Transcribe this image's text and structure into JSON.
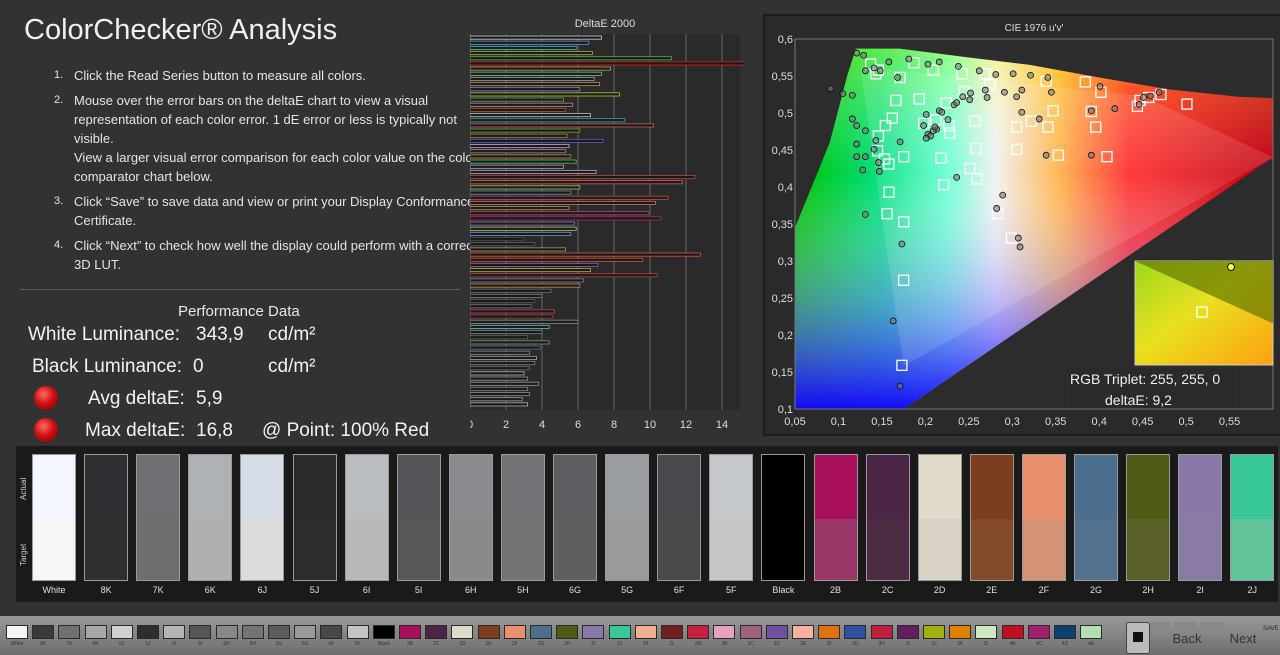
{
  "title": "ColorChecker® Analysis",
  "instructions": [
    {
      "num": "1.",
      "lines": [
        "Click the Read Series button to measure all colors."
      ]
    },
    {
      "num": "2.",
      "lines": [
        "Mouse over the error bars on the deltaE chart to view a visual representation of each color error. 1 dE error or less is typically not visible.",
        "View a larger visual error comparison for each color value on the color comparator chart below."
      ]
    },
    {
      "num": "3.",
      "lines": [
        "Click “Save” to save data and view or print your Display Conformance Certificate."
      ]
    },
    {
      "num": "4.",
      "lines": [
        "Click “Next” to check how well the display could perform with a corrective 3D LUT."
      ]
    }
  ],
  "performance": {
    "title": "Performance Data",
    "white_label": "White Luminance:",
    "white_value": "343,9",
    "white_unit": "cd/m²",
    "black_label": "Black Luminance:",
    "black_value": "0",
    "black_unit": "cd/m²",
    "avg_label": "Avg deltaE:",
    "avg_value": "5,9",
    "max_label": "Max deltaE:",
    "max_value": "16,8",
    "point_label": "@ Point: 100% Red"
  },
  "chart_data": [
    {
      "type": "bar",
      "title": "DeltaE 2000",
      "orientation": "horizontal",
      "xlim": [
        0,
        15
      ],
      "xticks": [
        "0",
        "2",
        "4",
        "6",
        "8",
        "10",
        "12",
        "14"
      ],
      "values": [
        7.3,
        6.6,
        5.9,
        6.8,
        11.2,
        16.8,
        7.8,
        7.3,
        6.9,
        7.2,
        6.1,
        8.3,
        5.2,
        5.7,
        5.3,
        6.7,
        8.6,
        10.2,
        6.1,
        5.4,
        7.4,
        5.5,
        5.3,
        5.6,
        5.9,
        5.2,
        7.0,
        12.5,
        11.8,
        6.1,
        5.6,
        11.0,
        10.3,
        5.5,
        9.9,
        10.6,
        5.8,
        5.9,
        5.6,
        3.0,
        3.6,
        5.3,
        12.8,
        9.6,
        7.1,
        6.7,
        10.4,
        6.3,
        6.1,
        4.5,
        4.0,
        3.6,
        3.4,
        4.7,
        4.6,
        6.0,
        4.4,
        4.0,
        3.2,
        4.4,
        3.9,
        3.3,
        3.7,
        3.6,
        3.3,
        3.0,
        3.2,
        3.8,
        3.2,
        3.3,
        2.9,
        3.2
      ],
      "colors": [
        "#d8d8d8",
        "#6a8fd0",
        "#40c0c0",
        "#b0b040",
        "#50b050",
        "#e02020",
        "#c0a060",
        "#80c080",
        "#a0a0a0",
        "#c09060",
        "#8080c0",
        "#c0c040",
        "#60a060",
        "#d080a0",
        "#a06030",
        "#c0c0c0",
        "#40a0a0",
        "#c06060",
        "#80a040",
        "#a08040",
        "#6060c0",
        "#d0a0c0",
        "#909090",
        "#c08040",
        "#60c060",
        "#a0a0d0",
        "#b0b0b0",
        "#c04040",
        "#d06060",
        "#b0c060",
        "#6090c0",
        "#c05050",
        "#d07070",
        "#a0a040",
        "#c04080",
        "#a03060",
        "#8080c0",
        "#c0c080",
        "#60a0c0",
        "#505050",
        "#606060",
        "#a0a060",
        "#e05050",
        "#c06040",
        "#a060a0",
        "#b0b040",
        "#c04040",
        "#8080a0",
        "#c09050",
        "#707070",
        "#808080",
        "#606060",
        "#707070",
        "#c04060",
        "#a04040",
        "#909090",
        "#60c0c0",
        "#808080",
        "#606060",
        "#70a070",
        "#607090",
        "#909090",
        "#a0a0a0",
        "#808080",
        "#707070",
        "#b0b0b0",
        "#909090",
        "#a0a0a0",
        "#808080",
        "#909090",
        "#a0a0a0",
        "#b0b0b0"
      ]
    },
    {
      "type": "scatter",
      "title": "CIE 1976 u'v'",
      "xlim": [
        0.05,
        0.6
      ],
      "ylim": [
        0.1,
        0.6
      ],
      "xticks": [
        "0,05",
        "0,1",
        "0,15",
        "0,2",
        "0,25",
        "0,3",
        "0,35",
        "0,4",
        "0,45",
        "0,5",
        "0,55"
      ],
      "yticks": [
        "0,6",
        "0,55",
        "0,5",
        "0,45",
        "0,4",
        "0,35",
        "0,3",
        "0,25",
        "0,2",
        "0,15",
        "0,1"
      ],
      "targets": [
        [
          0.137,
          0.566
        ],
        [
          0.146,
          0.558
        ],
        [
          0.143,
          0.553
        ],
        [
          0.171,
          0.548
        ],
        [
          0.187,
          0.568
        ],
        [
          0.209,
          0.558
        ],
        [
          0.242,
          0.553
        ],
        [
          0.269,
          0.553
        ],
        [
          0.274,
          0.538
        ],
        [
          0.339,
          0.543
        ],
        [
          0.384,
          0.542
        ],
        [
          0.402,
          0.528
        ],
        [
          0.447,
          0.517
        ],
        [
          0.457,
          0.521
        ],
        [
          0.391,
          0.502
        ],
        [
          0.347,
          0.503
        ],
        [
          0.322,
          0.489
        ],
        [
          0.245,
          0.529
        ],
        [
          0.224,
          0.514
        ],
        [
          0.193,
          0.519
        ],
        [
          0.166,
          0.517
        ],
        [
          0.162,
          0.493
        ],
        [
          0.154,
          0.483
        ],
        [
          0.146,
          0.469
        ],
        [
          0.145,
          0.449
        ],
        [
          0.153,
          0.438
        ],
        [
          0.158,
          0.431
        ],
        [
          0.175,
          0.441
        ],
        [
          0.198,
          0.486
        ],
        [
          0.212,
          0.491
        ],
        [
          0.228,
          0.473
        ],
        [
          0.257,
          0.489
        ],
        [
          0.218,
          0.439
        ],
        [
          0.251,
          0.425
        ],
        [
          0.259,
          0.411
        ],
        [
          0.221,
          0.403
        ],
        [
          0.158,
          0.393
        ],
        [
          0.156,
          0.364
        ],
        [
          0.175,
          0.353
        ],
        [
          0.283,
          0.364
        ],
        [
          0.299,
          0.331
        ],
        [
          0.353,
          0.443
        ],
        [
          0.305,
          0.451
        ],
        [
          0.175,
          0.274
        ],
        [
          0.173,
          0.159
        ],
        [
          0.409,
          0.441
        ],
        [
          0.501,
          0.512
        ],
        [
          0.471,
          0.525
        ],
        [
          0.444,
          0.509
        ],
        [
          0.396,
          0.481
        ],
        [
          0.341,
          0.481
        ],
        [
          0.305,
          0.481
        ],
        [
          0.258,
          0.452
        ],
        [
          0.227,
          0.483
        ]
      ],
      "measured": [
        [
          0.121,
          0.581
        ],
        [
          0.129,
          0.578
        ],
        [
          0.131,
          0.557
        ],
        [
          0.141,
          0.561
        ],
        [
          0.158,
          0.569
        ],
        [
          0.181,
          0.573
        ],
        [
          0.203,
          0.566
        ],
        [
          0.216,
          0.569
        ],
        [
          0.238,
          0.563
        ],
        [
          0.262,
          0.557
        ],
        [
          0.281,
          0.552
        ],
        [
          0.301,
          0.553
        ],
        [
          0.321,
          0.551
        ],
        [
          0.341,
          0.548
        ],
        [
          0.401,
          0.536
        ],
        [
          0.451,
          0.521
        ],
        [
          0.459,
          0.523
        ],
        [
          0.469,
          0.528
        ],
        [
          0.446,
          0.512
        ],
        [
          0.418,
          0.506
        ],
        [
          0.391,
          0.503
        ],
        [
          0.345,
          0.528
        ],
        [
          0.311,
          0.531
        ],
        [
          0.291,
          0.528
        ],
        [
          0.271,
          0.521
        ],
        [
          0.251,
          0.518
        ],
        [
          0.233,
          0.511
        ],
        [
          0.216,
          0.503
        ],
        [
          0.201,
          0.498
        ],
        [
          0.198,
          0.483
        ],
        [
          0.203,
          0.471
        ],
        [
          0.213,
          0.478
        ],
        [
          0.226,
          0.491
        ],
        [
          0.206,
          0.469
        ],
        [
          0.201,
          0.466
        ],
        [
          0.131,
          0.476
        ],
        [
          0.121,
          0.458
        ],
        [
          0.131,
          0.441
        ],
        [
          0.121,
          0.441
        ],
        [
          0.128,
          0.423
        ],
        [
          0.131,
          0.363
        ],
        [
          0.143,
          0.463
        ],
        [
          0.171,
          0.461
        ],
        [
          0.116,
          0.524
        ],
        [
          0.091,
          0.533
        ],
        [
          0.141,
          0.451
        ],
        [
          0.146,
          0.433
        ],
        [
          0.147,
          0.421
        ],
        [
          0.173,
          0.323
        ],
        [
          0.171,
          0.131
        ],
        [
          0.163,
          0.219
        ],
        [
          0.236,
          0.413
        ],
        [
          0.289,
          0.389
        ],
        [
          0.282,
          0.371
        ],
        [
          0.307,
          0.331
        ],
        [
          0.309,
          0.319
        ],
        [
          0.391,
          0.443
        ],
        [
          0.339,
          0.443
        ],
        [
          0.331,
          0.492
        ],
        [
          0.311,
          0.501
        ],
        [
          0.305,
          0.522
        ],
        [
          0.269,
          0.531
        ],
        [
          0.252,
          0.527
        ],
        [
          0.243,
          0.522
        ],
        [
          0.236,
          0.514
        ],
        [
          0.219,
          0.501
        ],
        [
          0.209,
          0.476
        ],
        [
          0.211,
          0.481
        ],
        [
          0.168,
          0.548
        ],
        [
          0.148,
          0.557
        ],
        [
          0.105,
          0.526
        ],
        [
          0.116,
          0.492
        ],
        [
          0.121,
          0.483
        ]
      ]
    }
  ],
  "tooltip": {
    "rgb_text": "RGB Triplet: 255, 255, 0",
    "de_text": "deltaE: 9,2"
  },
  "axis_labels": {
    "actual": "Actual",
    "target": "Target"
  },
  "swatches": [
    {
      "label": "White",
      "actual": "#f3f6ff",
      "target": "#f6f6f6"
    },
    {
      "label": "8K",
      "actual": "#2e2f33",
      "target": "#2f2f2f"
    },
    {
      "label": "7K",
      "actual": "#707074",
      "target": "#6e6e6e"
    },
    {
      "label": "6K",
      "actual": "#aeb1b6",
      "target": "#b0b0b0"
    },
    {
      "label": "6J",
      "actual": "#d6dce5",
      "target": "#dcdcdc"
    },
    {
      "label": "5J",
      "actual": "#2a2a2c",
      "target": "#2c2c2c"
    },
    {
      "label": "6I",
      "actual": "#b9bcc0",
      "target": "#b9b9b9"
    },
    {
      "label": "5I",
      "actual": "#55565a",
      "target": "#575757"
    },
    {
      "label": "6H",
      "actual": "#8b8c90",
      "target": "#8a8a8a"
    },
    {
      "label": "5H",
      "actual": "#727376",
      "target": "#737373"
    },
    {
      "label": "6G",
      "actual": "#5d5e62",
      "target": "#5f5f5f"
    },
    {
      "label": "5G",
      "actual": "#9a9da2",
      "target": "#9a9a9a"
    },
    {
      "label": "6F",
      "actual": "#48494c",
      "target": "#4a4a4a"
    },
    {
      "label": "5F",
      "actual": "#c4c7cc",
      "target": "#c6c6c6"
    },
    {
      "label": "Black",
      "actual": "#000000",
      "target": "#000000"
    },
    {
      "label": "2B",
      "actual": "#a8105d",
      "target": "#993868"
    },
    {
      "label": "2C",
      "actual": "#4a2545",
      "target": "#4d2c44"
    },
    {
      "label": "2D",
      "actual": "#e1dacb",
      "target": "#d9d3c6"
    },
    {
      "label": "2E",
      "actual": "#7d3d1f",
      "target": "#834a2a"
    },
    {
      "label": "2F",
      "actual": "#e8916c",
      "target": "#d69476"
    },
    {
      "label": "2G",
      "actual": "#4d6f8f",
      "target": "#557190"
    },
    {
      "label": "2H",
      "actual": "#4e5b14",
      "target": "#5a6028"
    },
    {
      "label": "2I",
      "actual": "#8a78a8",
      "target": "#8a7ba5"
    },
    {
      "label": "2J",
      "actual": "#38c898",
      "target": "#62c49a"
    }
  ],
  "thumbs": [
    "White",
    "8K",
    "7K",
    "6K",
    "6J",
    "5J",
    "6I",
    "5I",
    "6H",
    "5H",
    "6G",
    "5G",
    "6F",
    "5F",
    "Black",
    "2B",
    "2C",
    "2D",
    "2E",
    "2F",
    "2G",
    "2H",
    "2I",
    "2J",
    "2K",
    "2L",
    "2M",
    "3B",
    "3C",
    "3D",
    "3E",
    "3F",
    "3G",
    "3H",
    "3I",
    "3J",
    "3K",
    "3L",
    "4B",
    "4C",
    "4D",
    "4E"
  ],
  "thumb_colors": [
    "#f4f4f4",
    "#3a3a3a",
    "#707070",
    "#a8a8a8",
    "#d0d0d0",
    "#2e2e2e",
    "#b4b4b4",
    "#555555",
    "#888888",
    "#747474",
    "#5c5c5c",
    "#9a9a9a",
    "#484848",
    "#c4c4c4",
    "#000000",
    "#a8105d",
    "#4a2545",
    "#e1dacb",
    "#7d3d1f",
    "#e8916c",
    "#4d6f8f",
    "#4e5b14",
    "#8a78a8",
    "#38c898",
    "#f0b090",
    "#702020",
    "#c82040",
    "#e8a0c0",
    "#a06080",
    "#7050a0",
    "#f8b0a0",
    "#e07010",
    "#3050a0",
    "#c02040",
    "#602060",
    "#a0b010",
    "#e08000",
    "#d0e8c0",
    "#c01020",
    "#a02070",
    "#104070",
    "#b0e0b0"
  ],
  "nav": {
    "back": "Back",
    "next": "Next",
    "save": "SAVE"
  }
}
